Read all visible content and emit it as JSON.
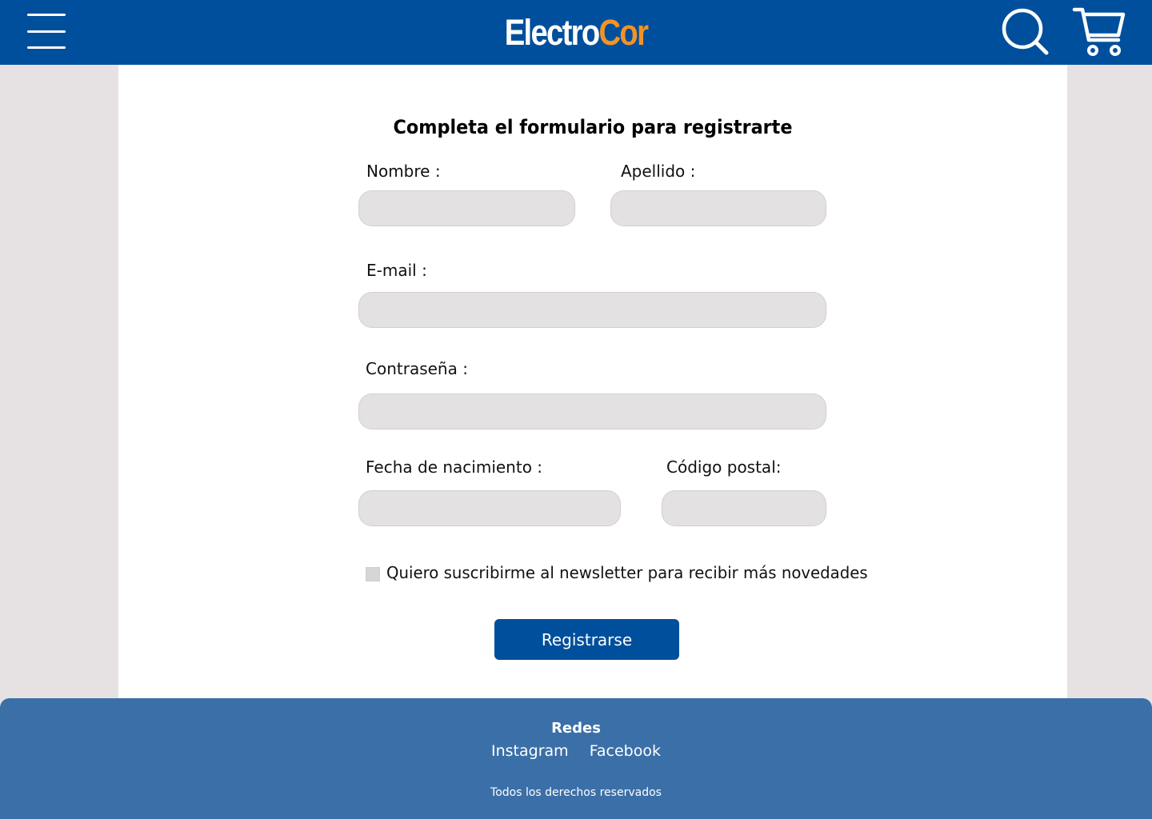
{
  "header": {
    "logo_part1": "Electro",
    "logo_part2": "Cor",
    "menu_icon": "hamburger-menu-icon",
    "search_icon": "search-icon",
    "cart_icon": "shopping-cart-icon"
  },
  "form": {
    "title": "Completa el formulario para registrarte",
    "nombre_label": "Nombre :",
    "nombre_value": "",
    "apellido_label": "Apellido :",
    "apellido_value": "",
    "email_label": "E-mail :",
    "email_value": "",
    "password_label": "Contraseña :",
    "password_value": "",
    "birthdate_label": "Fecha de nacimiento :",
    "birthdate_value": "",
    "zip_label": "Código postal:",
    "zip_value": "",
    "newsletter_label": "Quiero suscribirme al newsletter para recibir más novedades",
    "newsletter_checked": false,
    "submit_label": "Registrarse"
  },
  "footer": {
    "title": "Redes",
    "links": [
      "Instagram",
      "Facebook"
    ],
    "copyright": "Todos los derechos reservados"
  },
  "colors": {
    "header_bg": "#004f9c",
    "accent_orange": "#f39325",
    "footer_bg": "#3b6fa8",
    "page_bg": "#e6e2e3",
    "field_bg": "#e4e1e2"
  }
}
